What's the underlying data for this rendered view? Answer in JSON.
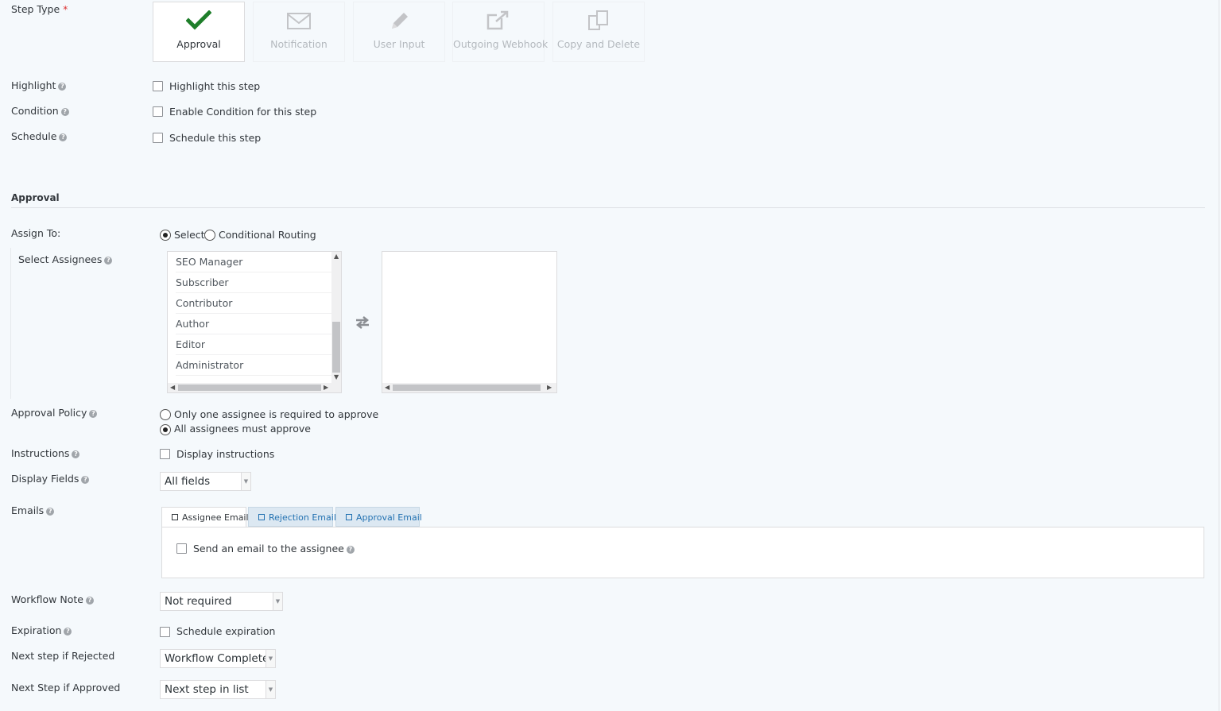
{
  "step_type": {
    "label": "Step Type",
    "required_mark": "*",
    "options": [
      {
        "label": "Approval",
        "icon": "checkmark-icon",
        "selected": true
      },
      {
        "label": "Notification",
        "icon": "envelope-icon",
        "selected": false
      },
      {
        "label": "User Input",
        "icon": "pencil-icon",
        "selected": false
      },
      {
        "label": "Outgoing Webhook",
        "icon": "external-link-icon",
        "selected": false
      },
      {
        "label": "Copy and Delete",
        "icon": "copy-icon",
        "selected": false
      }
    ]
  },
  "highlight": {
    "label": "Highlight",
    "option": "Highlight this step",
    "checked": false
  },
  "condition": {
    "label": "Condition",
    "option": "Enable Condition for this step",
    "checked": false
  },
  "schedule": {
    "label": "Schedule",
    "option": "Schedule this step",
    "checked": false
  },
  "section_title": "Approval",
  "assign_to": {
    "label": "Assign To:",
    "options": [
      {
        "label": "Select",
        "selected": true
      },
      {
        "label": "Conditional Routing",
        "selected": false
      }
    ]
  },
  "select_assignees": {
    "label": "Select Assignees",
    "available": [
      "SEO Manager",
      "Subscriber",
      "Contributor",
      "Author",
      "Editor",
      "Administrator"
    ],
    "selected": []
  },
  "approval_policy": {
    "label": "Approval Policy",
    "options": [
      {
        "label": "Only one assignee is required to approve",
        "selected": false
      },
      {
        "label": "All assignees must approve",
        "selected": true
      }
    ]
  },
  "instructions": {
    "label": "Instructions",
    "option": "Display instructions",
    "checked": false
  },
  "display_fields": {
    "label": "Display Fields",
    "value": "All fields"
  },
  "emails": {
    "label": "Emails",
    "tabs": [
      {
        "label": "Assignee Email",
        "active": true
      },
      {
        "label": "Rejection Email",
        "active": false
      },
      {
        "label": "Approval Email",
        "active": false
      }
    ],
    "send_option": "Send an email to the assignee"
  },
  "workflow_note": {
    "label": "Workflow Note",
    "value": "Not required"
  },
  "expiration": {
    "label": "Expiration",
    "option": "Schedule expiration",
    "checked": false
  },
  "next_rejected": {
    "label": "Next step if Rejected",
    "value": "Workflow Complete"
  },
  "next_approved": {
    "label": "Next Step if Approved",
    "value": "Next step in list"
  },
  "colors": {
    "accent_green": "#1e7e2a",
    "link_blue": "#2271b1",
    "background": "#f5f9fc"
  }
}
